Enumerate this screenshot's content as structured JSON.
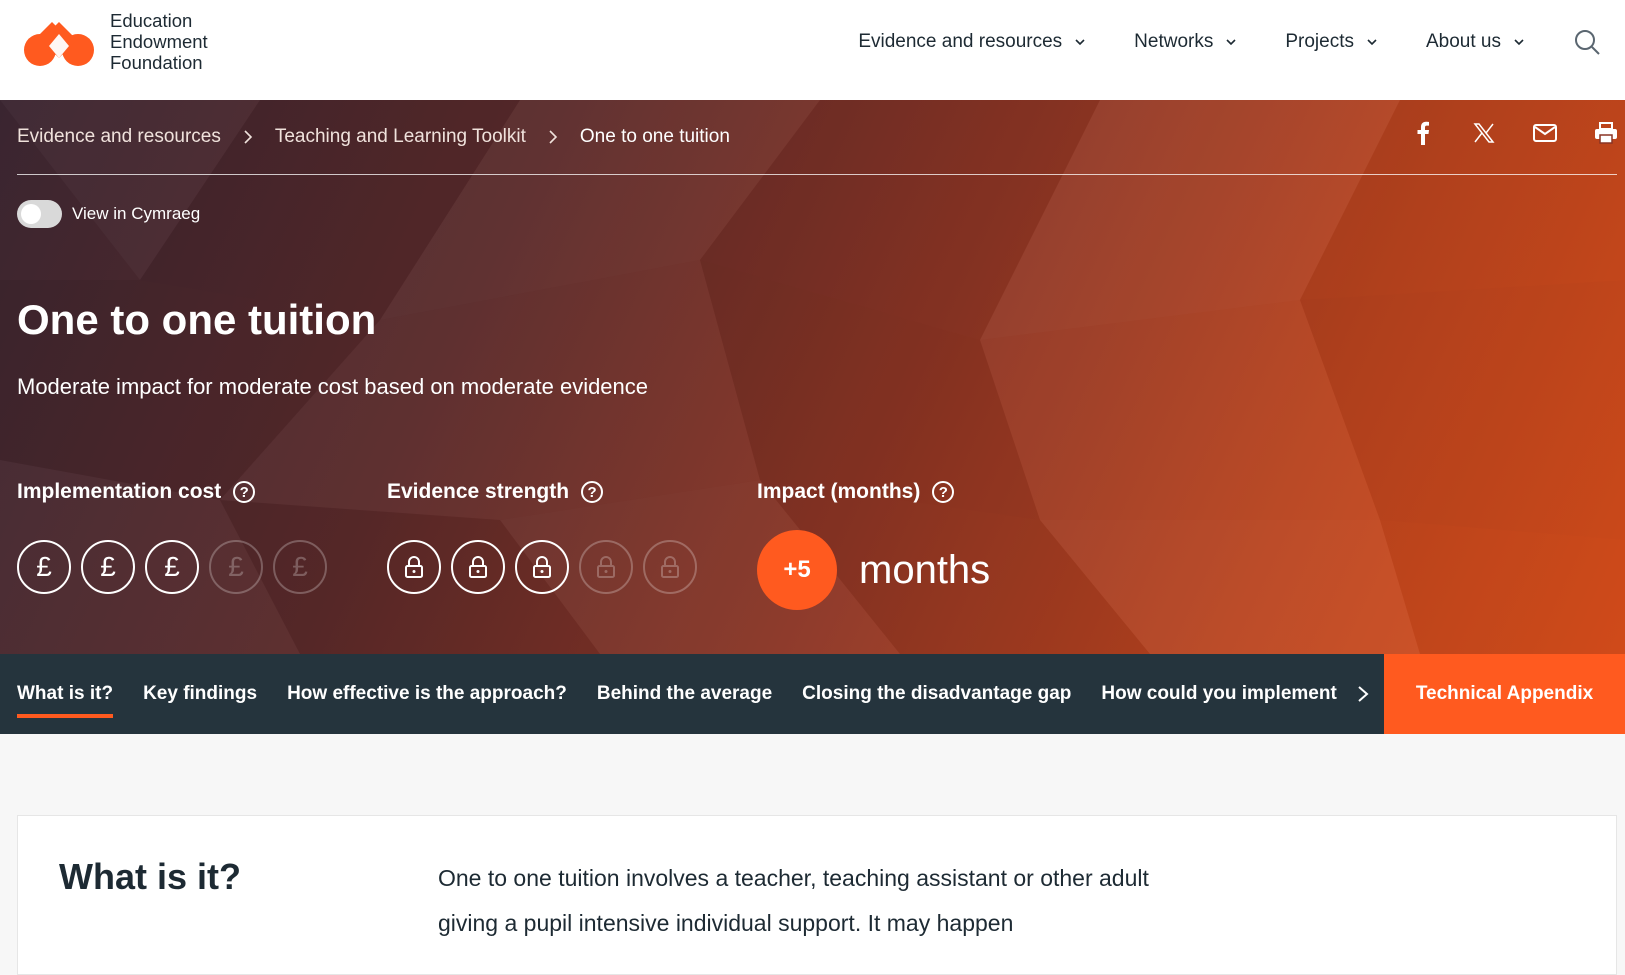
{
  "brand": {
    "line1": "Education",
    "line2": "Endowment",
    "line3": "Foundation",
    "accent": "#ff5a1f",
    "dark": "#25343d"
  },
  "nav": {
    "items": [
      {
        "label": "Evidence and resources"
      },
      {
        "label": "Networks"
      },
      {
        "label": "Projects"
      },
      {
        "label": "About us"
      }
    ],
    "search_icon": "search-icon"
  },
  "breadcrumb": {
    "items": [
      {
        "label": "Evidence and resources"
      },
      {
        "label": "Teaching and Learning Toolkit"
      },
      {
        "label": "One to one tuition"
      }
    ]
  },
  "share": {
    "icons": [
      "facebook-icon",
      "x-icon",
      "email-icon",
      "print-icon"
    ]
  },
  "toggle": {
    "label": "View in Cymraeg",
    "on": false
  },
  "hero": {
    "title": "One to one tuition",
    "subtitle": "Moderate impact for moderate cost based on moderate evidence"
  },
  "metrics": {
    "cost": {
      "title": "Implementation cost",
      "symbol": "£",
      "level": 3,
      "max": 5
    },
    "evidence": {
      "title": "Evidence strength",
      "symbol": "lock-icon",
      "level": 3,
      "max": 5
    },
    "impact": {
      "title": "Impact (months)",
      "value": "+5",
      "unit": "months"
    },
    "help_glyph": "?"
  },
  "tabs": {
    "items": [
      {
        "label": "What is it?",
        "active": true
      },
      {
        "label": "Key findings"
      },
      {
        "label": "How effective is the approach?"
      },
      {
        "label": "Behind the average"
      },
      {
        "label": "Closing the disadvantage gap"
      },
      {
        "label": "How could you implement i"
      }
    ],
    "technical_appendix": "Technical Appendix"
  },
  "content": {
    "heading": "What is it?",
    "body": "One to one tuition involves a teacher, teaching assistant or other adult giving a pupil intensive individual support. It may happen"
  }
}
